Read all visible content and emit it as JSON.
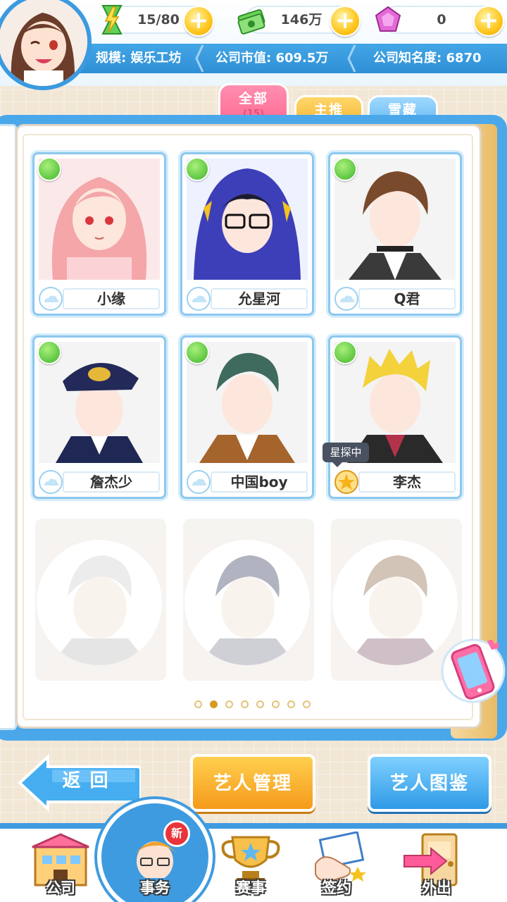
{
  "resources": {
    "energy": "15/80",
    "money": "146万",
    "gems": "0"
  },
  "company": {
    "scale": "规模: 娱乐工坊",
    "market_value": "公司市值: 609.5万",
    "fame": "公司知名度: 6870"
  },
  "tabs": [
    {
      "label": "全部",
      "count": "(15)"
    },
    {
      "label": "主推"
    },
    {
      "label": "雪藏"
    }
  ],
  "artists": [
    {
      "name": "小缘"
    },
    {
      "name": "允星河"
    },
    {
      "name": "Q君"
    },
    {
      "name": "詹杰少"
    },
    {
      "name": "中国boy"
    },
    {
      "name": "李杰",
      "status_tag": "星探中"
    }
  ],
  "pagination": {
    "pages": 8,
    "current": 2
  },
  "buttons": {
    "back": "返 回",
    "manage": "艺人管理",
    "gallery": "艺人图鉴"
  },
  "nav": {
    "company": "公司",
    "affairs": "事务",
    "events": "赛事",
    "sign": "签约",
    "outing": "外出",
    "new_badge": "新"
  },
  "colors": {
    "primary_blue": "#3f9be0",
    "accent_orange": "#f59a1a",
    "tab_pink": "#ff6a93",
    "status_green": "#3fb52a"
  }
}
